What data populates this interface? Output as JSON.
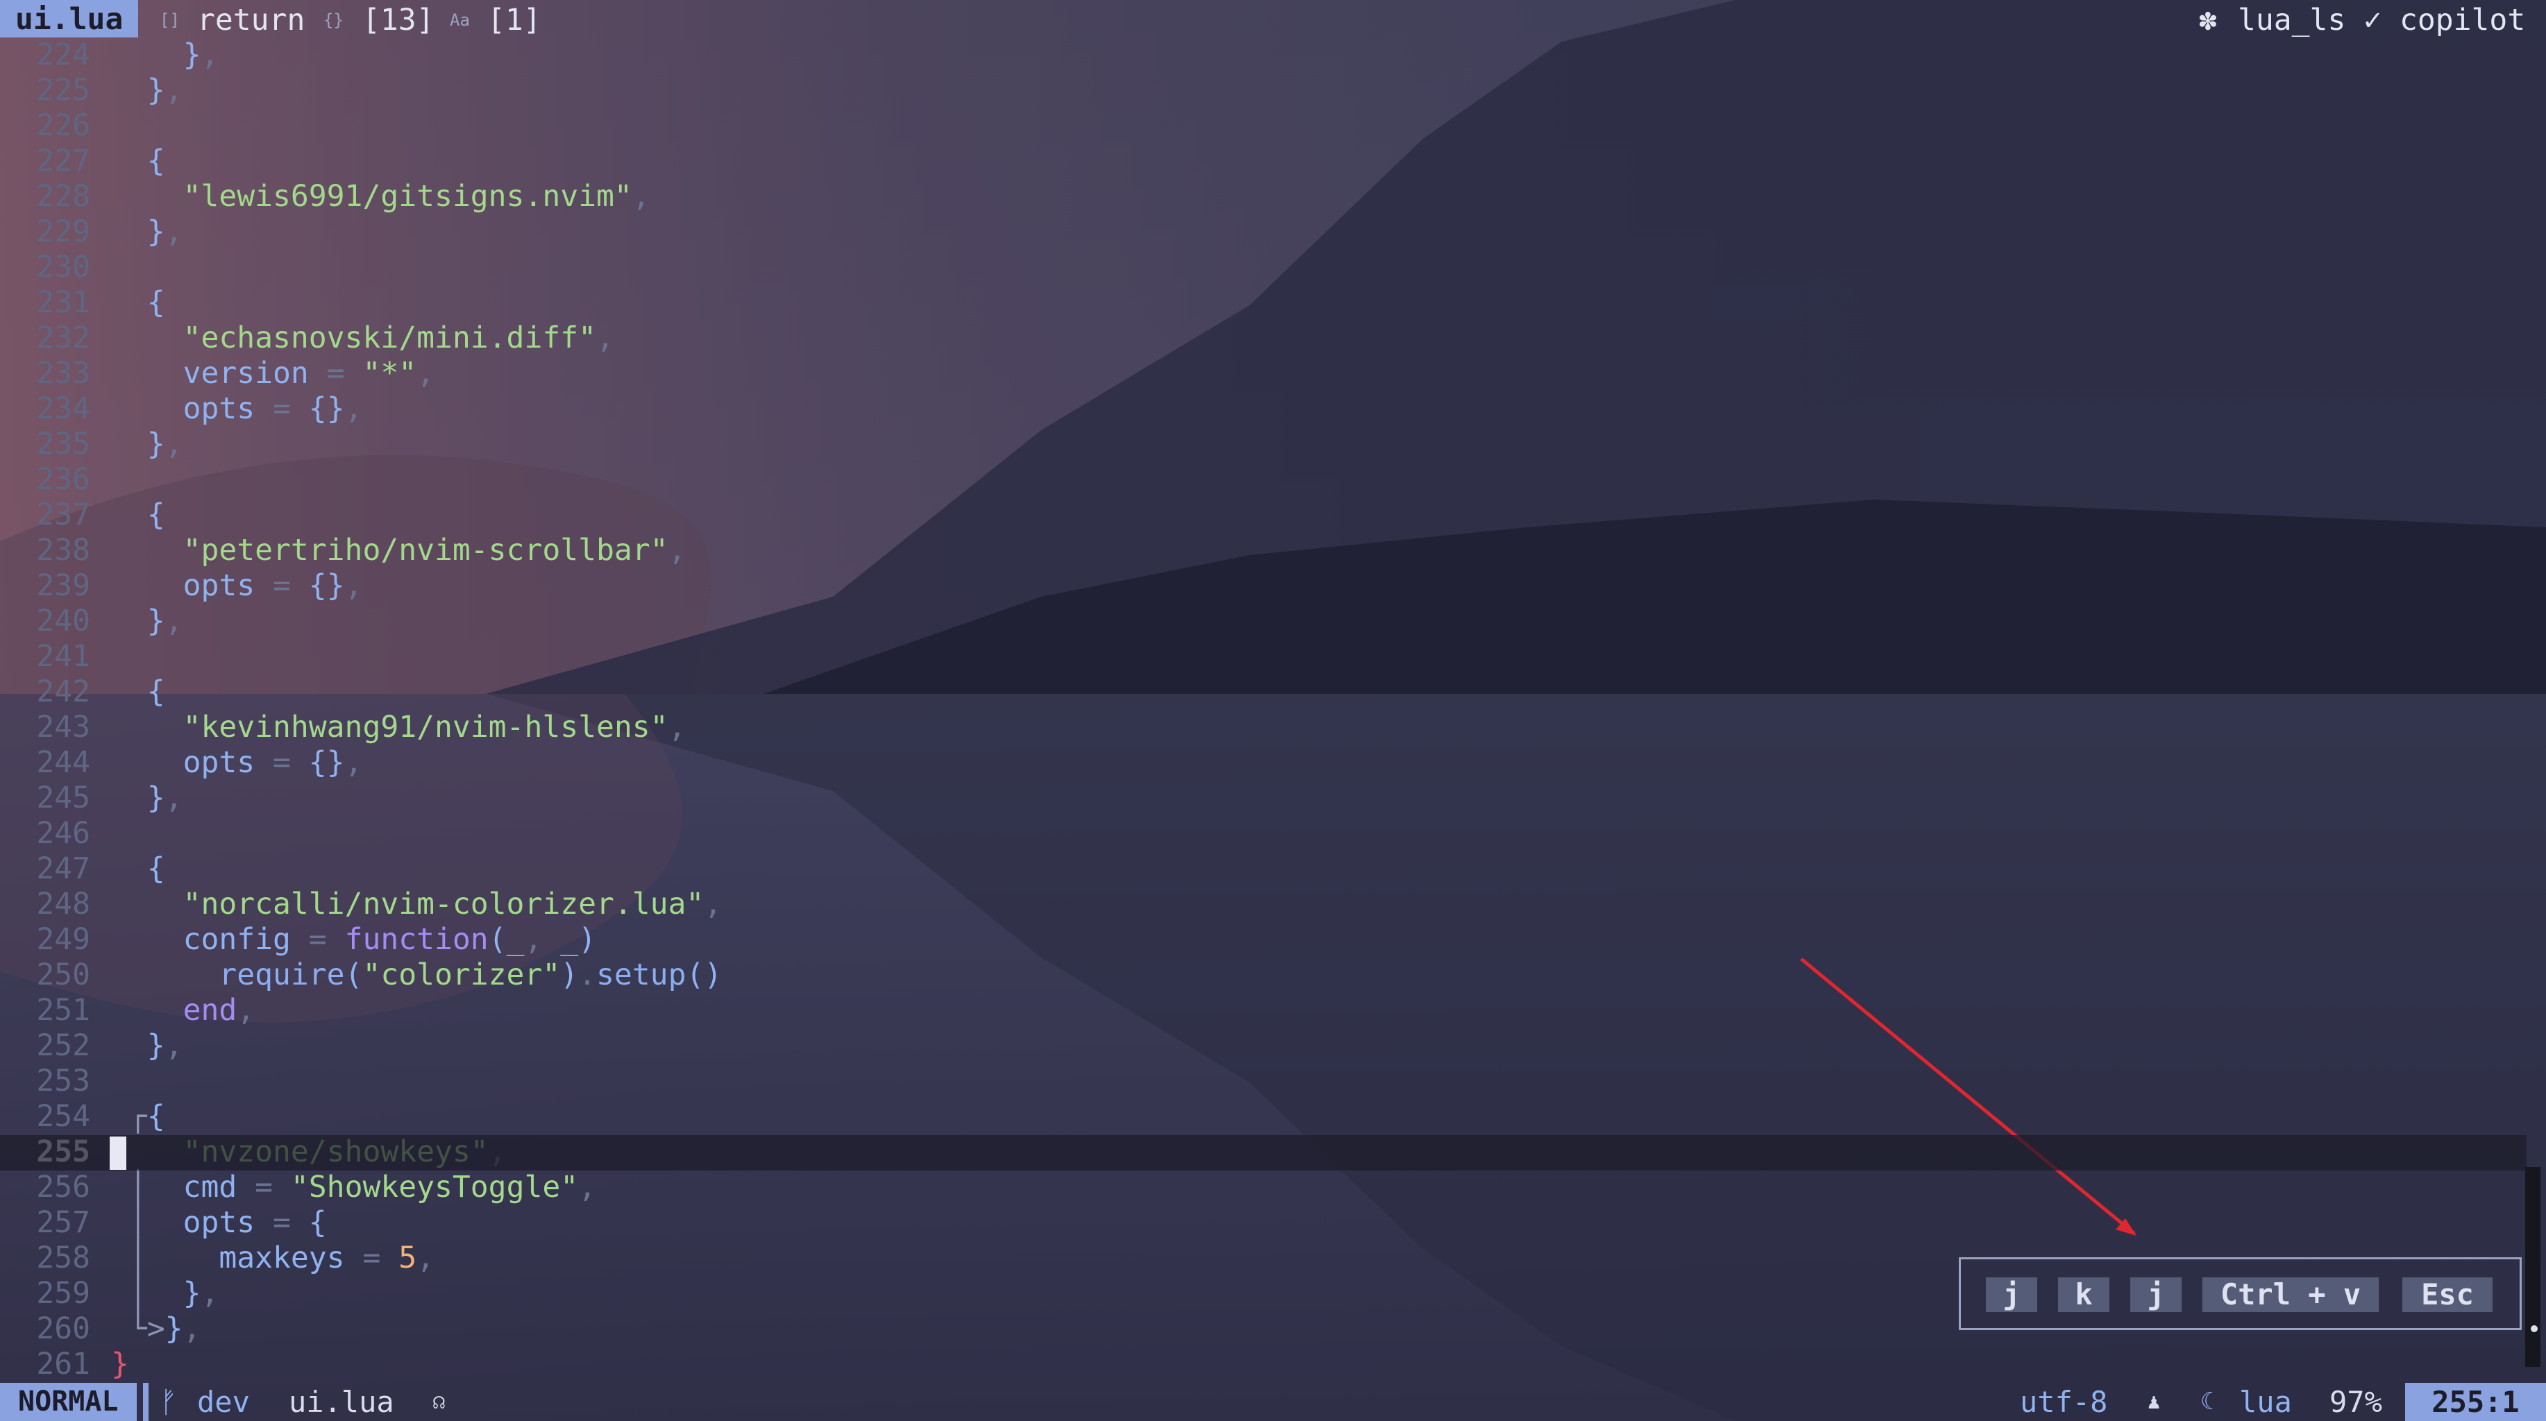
{
  "winbar": {
    "file": "ui.lua",
    "crumbs": [
      {
        "icon": "[]",
        "icon_name": "array-icon",
        "text": "return"
      },
      {
        "icon": "{}",
        "icon_name": "object-icon",
        "text": "[13]"
      },
      {
        "icon": "Aa",
        "icon_name": "string-icon",
        "text": "[1]"
      }
    ],
    "lsp_icon": "✽",
    "lsp": "lua_ls ✓ copilot"
  },
  "editor": {
    "current_line": 255,
    "lines": [
      {
        "n": "224",
        "t": "    },"
      },
      {
        "n": "225",
        "t": "  },"
      },
      {
        "n": "226",
        "t": ""
      },
      {
        "n": "227",
        "t": "  {"
      },
      {
        "n": "228",
        "t": "    \"lewis6991/gitsigns.nvim\","
      },
      {
        "n": "229",
        "t": "  },"
      },
      {
        "n": "230",
        "t": ""
      },
      {
        "n": "231",
        "t": "  {"
      },
      {
        "n": "232",
        "t": "    \"echasnovski/mini.diff\","
      },
      {
        "n": "233",
        "t": "    version = \"*\","
      },
      {
        "n": "234",
        "t": "    opts = {},"
      },
      {
        "n": "235",
        "t": "  },"
      },
      {
        "n": "236",
        "t": ""
      },
      {
        "n": "237",
        "t": "  {"
      },
      {
        "n": "238",
        "t": "    \"petertriho/nvim-scrollbar\","
      },
      {
        "n": "239",
        "t": "    opts = {},"
      },
      {
        "n": "240",
        "t": "  },"
      },
      {
        "n": "241",
        "t": ""
      },
      {
        "n": "242",
        "t": "  {"
      },
      {
        "n": "243",
        "t": "    \"kevinhwang91/nvim-hlslens\","
      },
      {
        "n": "244",
        "t": "    opts = {},"
      },
      {
        "n": "245",
        "t": "  },"
      },
      {
        "n": "246",
        "t": ""
      },
      {
        "n": "247",
        "t": "  {"
      },
      {
        "n": "248",
        "t": "    \"norcalli/nvim-colorizer.lua\","
      },
      {
        "n": "249",
        "t": "    config = function(_, _)"
      },
      {
        "n": "250",
        "t": "      require(\"colorizer\").setup()"
      },
      {
        "n": "251",
        "t": "    end,"
      },
      {
        "n": "252",
        "t": "  },"
      },
      {
        "n": "253",
        "t": ""
      },
      {
        "n": "254",
        "t": " ┌{"
      },
      {
        "n": "255",
        "t": "    \"nvzone/showkeys\","
      },
      {
        "n": "256",
        "t": " │  cmd = \"ShowkeysToggle\","
      },
      {
        "n": "257",
        "t": " │  opts = {"
      },
      {
        "n": "258",
        "t": " │    maxkeys = 5,"
      },
      {
        "n": "259",
        "t": " │  },"
      },
      {
        "n": "260",
        "t": " └>},"
      },
      {
        "n": "261",
        "t": "}"
      }
    ]
  },
  "showkeys": {
    "keys": [
      "j",
      "k",
      "j",
      "Ctrl + v",
      "Esc"
    ]
  },
  "statusline": {
    "mode": "NORMAL",
    "branch_icon": "ᚠ",
    "branch": "dev",
    "file": "ui.lua",
    "copilot_icon": "☊",
    "encoding": "utf-8",
    "os_icon": "♟",
    "filetype_icon": "☾",
    "filetype": "lua",
    "progress": "97%",
    "position": "255:1"
  },
  "colors": {
    "accent": "#8aa2e0",
    "string": "#a3d98a",
    "keyword": "#a48cf2",
    "number": "#f2b278",
    "annotation_arrow": "#e0262e"
  }
}
